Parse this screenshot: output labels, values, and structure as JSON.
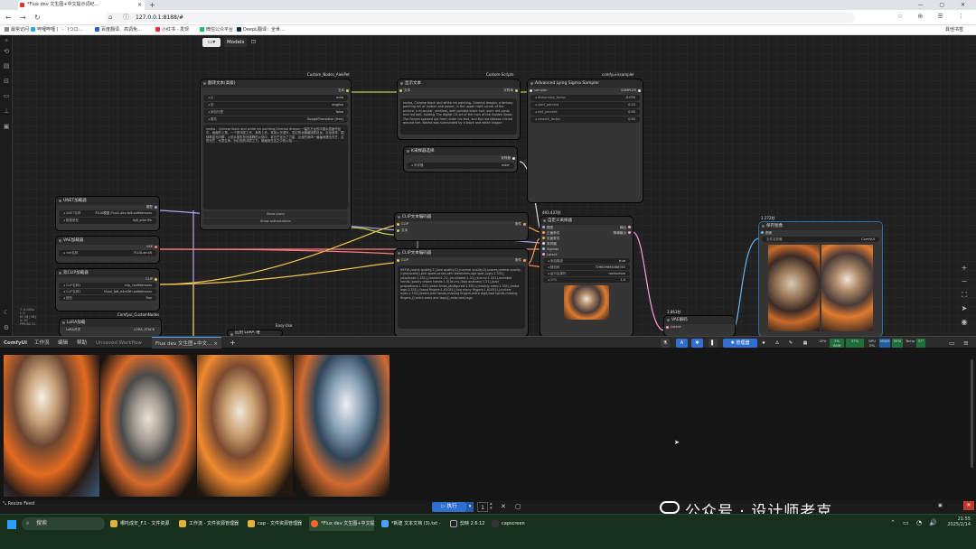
{
  "browser": {
    "tab_title": "*Flux dev 文生图+中文提示词纪…",
    "url": "127.0.0.1:8188/#",
    "bookmarks": [
      "最常访问",
      "哔哩哔哩 ( ˊ- ˋ)つロ…",
      "百度翻译、高调免…",
      "小红书 - 发现",
      "微信公众平台",
      "DeepL翻译：全世…"
    ],
    "bookmarks_right": "其他书签"
  },
  "comfy": {
    "folder_btn": "▾",
    "models_btn": "Models",
    "nodes": {
      "translate": {
        "tag": "Custom_Nodes_AlekPet",
        "title": "翻译文本(高级)",
        "out": "文本",
        "rows": [
          {
            "k": "从",
            "v": "auto"
          },
          {
            "k": "到",
            "v": "english"
          },
          {
            "k": "添加代理",
            "v": "false"
          },
          {
            "k": "服务",
            "v": "GoogleTranslator (free)"
          }
        ],
        "text": "nezha，Chinese black and white ink painting,Oriental dragon,一幅东方龙的中国水墨画作品中，画面的上角，一个是鸿蒙之光，身着上衣，背景火光漫天，变幻的龙鳞缠绕着巨龙，巨龙身体，围绕着金光闪耀，火焰从那炙热而沸腾的火焰中，将光芒化为了力量，巨龙的身体一遍遍地透出光芒，这些光芒，代表生命，为红色的鸿蒙之力，被缠绕在这之中的火焰……",
        "btn1": "Show proxy",
        "btn2": "Show authorization"
      },
      "show_text": {
        "tag": "Custom-Scripts",
        "title": "显示文本",
        "in": "文本",
        "out": "字符串",
        "text": "nezha, Chinese black and white ink painting, Oriental dragon, a fantasy painting full of motion and power, in the upper right corner of the picture, a muscular, shirtless, with pointed black hair, worn red pants and red belt, holding The digital CG art of the man of the Golden Spear. The flames spewed out from under his feet, and the red ribbons circled around him. Nezha was surrounded by a black and white dragon"
      },
      "sampler_select": {
        "title": "K采样器选择",
        "out": "采样器",
        "row": {
          "k": "采样器",
          "v": "euler"
        }
      },
      "lying": {
        "tag": "comfyui-ksampler",
        "title": "Advanced Lying Sigma Sampler",
        "in": "sampler",
        "out": "SAMPLER",
        "rows": [
          {
            "k": "dishonesty_factor",
            "v": "-0.050"
          },
          {
            "k": "start_percent",
            "v": "0.10"
          },
          {
            "k": "end_percent",
            "v": "0.90"
          },
          {
            "k": "smooth_factor",
            "v": "0.50"
          }
        ]
      },
      "unet": {
        "title": "UNET加载器",
        "out": "模型",
        "rows": [
          {
            "k": "UNET名称",
            "v": "FLUX模型-Flux1-dev-fp8.safetensors"
          },
          {
            "k": "数据类型",
            "v": "fp8_e4m3fn"
          }
        ]
      },
      "vae": {
        "title": "VAE加载器",
        "out": "VAE",
        "rows": [
          {
            "k": "vae名称",
            "v": "FLUX.ae.sft"
          }
        ]
      },
      "dualclip": {
        "title": "双CLIP加载器",
        "out": "CLIP",
        "rows": [
          {
            "k": "CLIP名称1",
            "v": "clip_l.safetensors"
          },
          {
            "k": "CLIP名称2",
            "v": "t5xxl_fp8_e4m3fn.safetensors"
          },
          {
            "k": "类型",
            "v": "flux"
          }
        ],
        "foot": "Comfyui_CustomNodes"
      },
      "lora": {
        "title": "LoRA加载",
        "out1": "LORA_STACK",
        "row": "LoRA开关"
      },
      "lora2": {
        "title": "应用 LoRA 堆"
      },
      "easyuse": {
        "tag": "Easy-Use"
      },
      "clip_enc1": {
        "title": "CLIP文本编码器",
        "in1": "CLIP",
        "in2": "文本",
        "out": "条件"
      },
      "clip_enc2": {
        "title": "CLIP文本编码器",
        "in": "CLIP",
        "out": "条件",
        "text": "NSFW,(worst quality:2),(low quality:2),(normal quality:2),lowres,normal quality,((grayscale)),skin spots,acnes,skin blemishes,age spot,(ugly:1.331),(duplicate:1.331),(morbid:1.21),(mutilated:1.21),(tranny:1.331),mutated hands,(poorly drawn hands:1.5),blurry,(bad anatomy:1.21),(bad proportions:1.331),extra limbs,(disfigured:1.331),(missing arms:1.331),(extra legs:1.331),(fused fingers:1.61051),(too many fingers:1.61051),(unclear eyes:1.331),lowers,bad hands,missing fingers,extra digit,bad hands,missing fingers,(((extra arms and legs))),nsfw,text,logo"
      },
      "custom_sampler": {
        "tag": "493.437秒",
        "title": "自定义采样器",
        "ins": [
          "模型",
          "正面条件",
          "负面条件",
          "采样器",
          "Sigmas",
          "Latent"
        ],
        "outs": [
          "输出",
          "降噪输出"
        ],
        "rows": [
          {
            "k": "添加噪波",
            "v": "true"
          },
          {
            "k": "随机种",
            "v": "729809898088785"
          },
          {
            "k": "运行后操作",
            "v": "randomize"
          },
          {
            "k": "CFG",
            "v": "1.0"
          }
        ]
      },
      "vae_decode": {
        "tag": "2.863秒",
        "title": "VAE解码",
        "in": "Latent"
      },
      "save": {
        "tag": "1.272秒",
        "title": "保存图像",
        "in": "图像",
        "row": {
          "k": "文件名前缀",
          "v": "ComfyUI"
        }
      }
    },
    "left_info": "T: 0.000s\nI: 0\nN: 16 [16]\nV: 37\nFPS:62.31"
  },
  "tabsbar": {
    "brand": "ComfyUI",
    "menus": [
      "工作流",
      "编辑",
      "帮助"
    ],
    "tabs": [
      "Unsaved Workflow",
      "Flux dev 文生图+中文…"
    ],
    "manager_btn": "管理器",
    "stats": [
      {
        "k": "CPU",
        "v": "3%"
      },
      {
        "k": "RAM",
        "v": "37%"
      },
      {
        "k": "GPU",
        "v": "0%"
      },
      {
        "k": "VRAM",
        "v": "55%"
      },
      {
        "k": "Temp",
        "v": "37°"
      }
    ]
  },
  "queue": {
    "run_label": "执行",
    "count": "1",
    "resize": "Resize Feed"
  },
  "watermark": "公众号 · 设计师老克",
  "taskbar": {
    "search": "搜索",
    "items": [
      "哪吒成年_F.1 - 文件资源",
      "工作流 - 文件资源管理器",
      "cap - 文件资源管理器",
      "*Flux dev 文生图+中文提",
      "*新建 文本文档 (3).txt - ",
      "剪映 2.6.12",
      "capscreen"
    ],
    "time": "21:55",
    "date": "2025/2/14"
  }
}
